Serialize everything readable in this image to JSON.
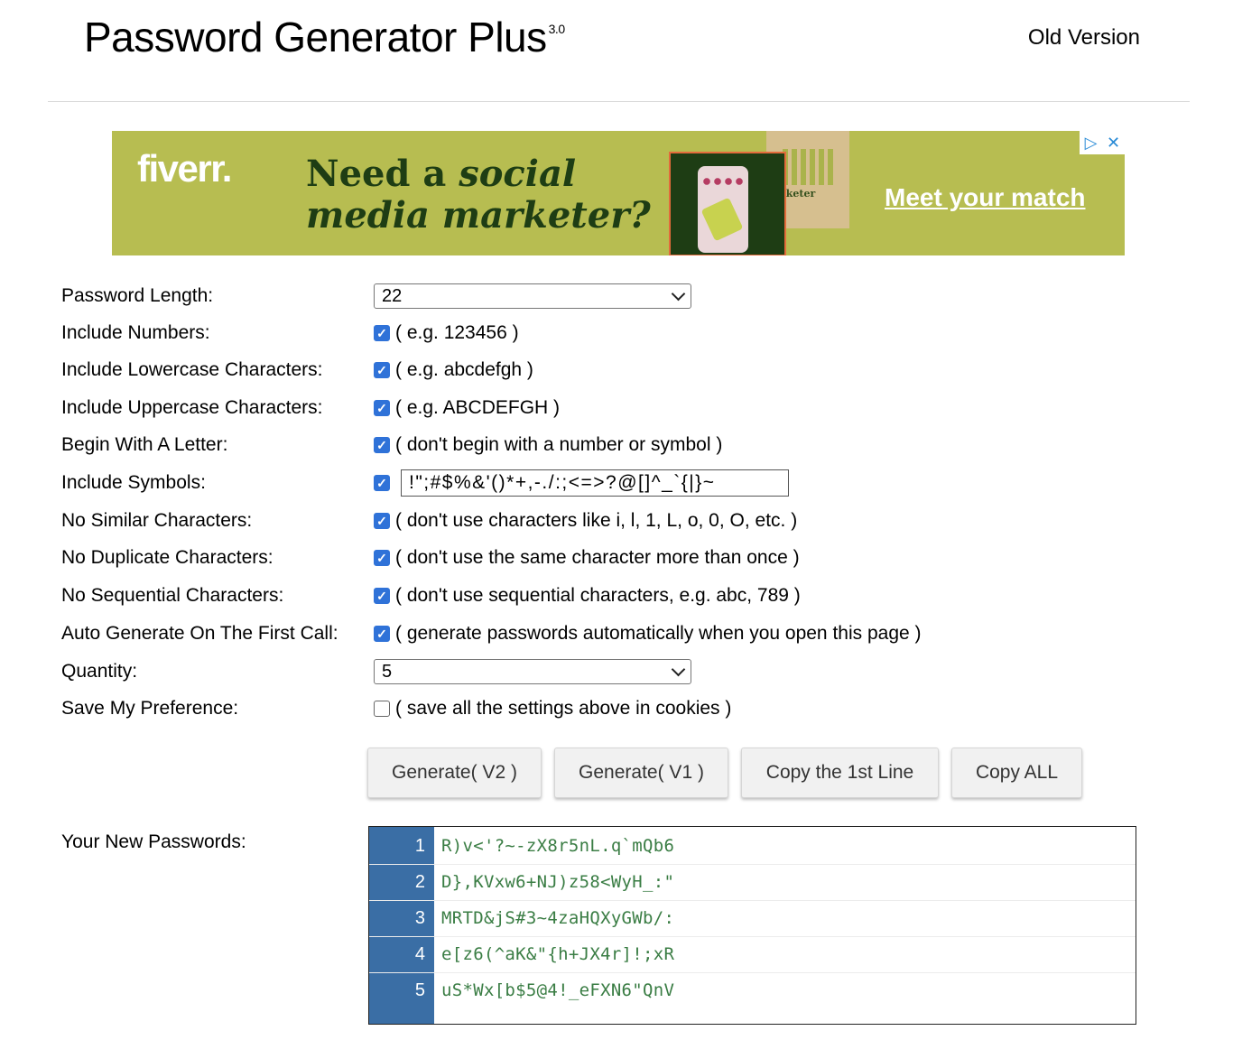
{
  "header": {
    "title": "Password Generator Plus",
    "version": "3.0",
    "old_version_link": "Old Version"
  },
  "ad": {
    "logo": "fiverr.",
    "headline_1a": "Need a ",
    "headline_1b": "social",
    "headline_2": "media marketer?",
    "card_text": "rketer",
    "cta": "Meet your match",
    "choices_icons": [
      "adchoices-icon",
      "close-icon"
    ]
  },
  "form": {
    "password_length": {
      "label": "Password Length:",
      "value": "22"
    },
    "include_numbers": {
      "label": "Include Numbers:",
      "checked": true,
      "hint": "( e.g. 123456 )"
    },
    "include_lowercase": {
      "label": "Include Lowercase Characters:",
      "checked": true,
      "hint": "( e.g. abcdefgh )"
    },
    "include_uppercase": {
      "label": "Include Uppercase Characters:",
      "checked": true,
      "hint": "( e.g. ABCDEFGH )"
    },
    "begin_with_letter": {
      "label": "Begin With A Letter:",
      "checked": true,
      "hint": "( don't begin with a number or symbol )"
    },
    "include_symbols": {
      "label": "Include Symbols:",
      "checked": true,
      "value": "!\";#$%&'()*+,-./:;<=>?@[]^_`{|}~"
    },
    "no_similar": {
      "label": "No Similar Characters:",
      "checked": true,
      "hint": "( don't use characters like i, l, 1, L, o, 0, O, etc. )"
    },
    "no_duplicate": {
      "label": "No Duplicate Characters:",
      "checked": true,
      "hint": "( don't use the same character more than once )"
    },
    "no_sequential": {
      "label": "No Sequential Characters:",
      "checked": true,
      "hint": "( don't use sequential characters, e.g. abc, 789 )"
    },
    "auto_generate": {
      "label": "Auto Generate On The First Call:",
      "checked": true,
      "hint": "( generate passwords automatically when you open this page )"
    },
    "quantity": {
      "label": "Quantity:",
      "value": "5"
    },
    "save_preference": {
      "label": "Save My Preference:",
      "checked": false,
      "hint": "( save all the settings above in cookies )"
    }
  },
  "buttons": {
    "generate_v2": "Generate( V2 )",
    "generate_v1": "Generate( V1 )",
    "copy_first": "Copy the 1st Line",
    "copy_all": "Copy ALL"
  },
  "output": {
    "label": "Your New Passwords:",
    "lines": [
      {
        "num": "1",
        "password": "R)v<'?~-zX8r5nL.q`mQb6"
      },
      {
        "num": "2",
        "password": "D},KVxw6+NJ)z58<WyH_:\""
      },
      {
        "num": "3",
        "password": "MRTD&jS#3~4zaHQXyGWb/:"
      },
      {
        "num": "4",
        "password": "e[z6(^aK&\"{h+JX4r]!;xR"
      },
      {
        "num": "5",
        "password": "uS*Wx[b$5@4!_eFXN6\"QnV"
      }
    ]
  },
  "colors": {
    "ad_background": "#b7bd51",
    "checkbox_accent": "#2f72d8",
    "gutter": "#3a6ea5",
    "password_text": "#3a7d44"
  }
}
